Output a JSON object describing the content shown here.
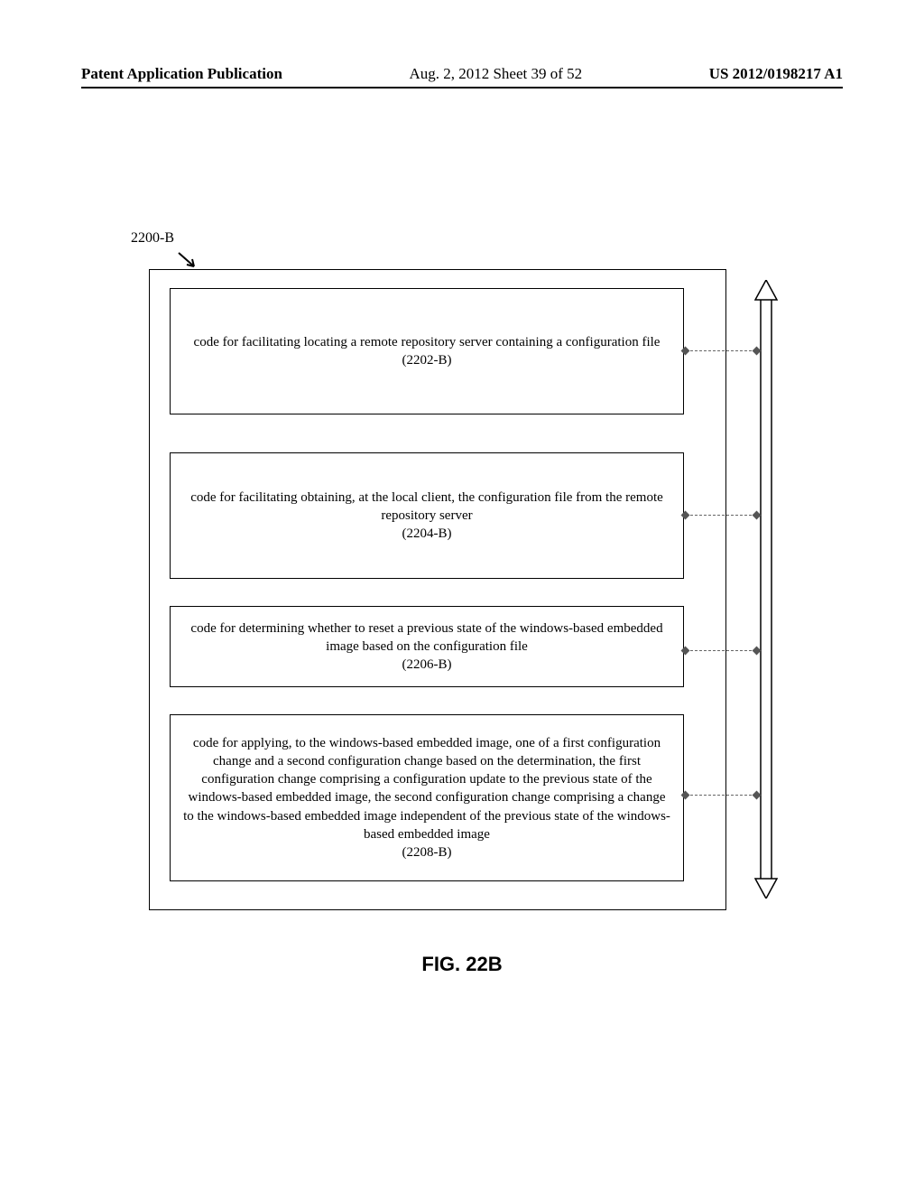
{
  "header": {
    "left": "Patent Application Publication",
    "center": "Aug. 2, 2012  Sheet 39 of 52",
    "right": "US 2012/0198217 A1"
  },
  "figure": {
    "ref_label": "2200-B",
    "caption": "FIG. 22B",
    "blocks": [
      {
        "text": "code for facilitating locating a remote repository server containing a configuration file",
        "id": "(2202-B)"
      },
      {
        "text": "code for facilitating obtaining, at the local client, the configuration file from the remote repository server",
        "id": "(2204-B)"
      },
      {
        "text": "code for determining whether to reset a previous state of the windows-based embedded image based on the configuration file",
        "id": "(2206-B)"
      },
      {
        "text": "code for applying, to the windows-based embedded image, one of a first configuration change and a second configuration change based on the determination, the first configuration change comprising a configuration update to the previous state of the windows-based embedded image, the second configuration change comprising a change to the windows-based embedded image independent of the previous state of the windows-based embedded image",
        "id": "(2208-B)"
      }
    ]
  }
}
